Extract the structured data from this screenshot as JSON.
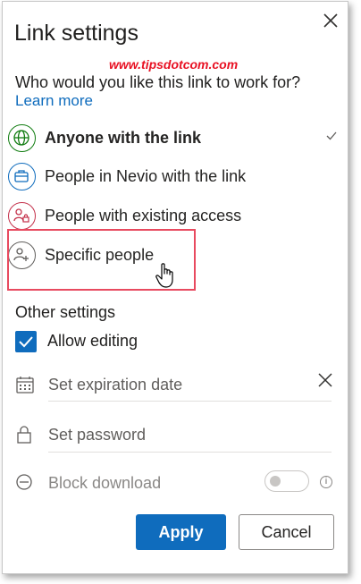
{
  "dialog": {
    "title": "Link settings",
    "watermark": "www.tipsdotcom.com",
    "question": "Who would you like this link to work for?",
    "learn_more": "Learn more"
  },
  "options": [
    {
      "label": "Anyone with the link",
      "icon": "globe-icon",
      "color": "#107c10",
      "selected": true
    },
    {
      "label": "People in Nevio with the link",
      "icon": "briefcase-icon",
      "color": "#0f6cbd",
      "selected": false
    },
    {
      "label": "People with existing access",
      "icon": "people-lock-icon",
      "color": "#c4314b",
      "selected": false
    },
    {
      "label": "Specific people",
      "icon": "people-add-icon",
      "color": "#605e5c",
      "selected": false
    }
  ],
  "other": {
    "heading": "Other settings",
    "allow_editing": "Allow editing",
    "allow_editing_checked": true,
    "expiration": "Set expiration date",
    "password": "Set password",
    "block_download": "Block download",
    "block_download_on": false,
    "info": "i"
  },
  "buttons": {
    "apply": "Apply",
    "cancel": "Cancel"
  },
  "colors": {
    "accent": "#0f6cbd",
    "highlight": "#e84a5f",
    "watermark": "#e81123"
  }
}
